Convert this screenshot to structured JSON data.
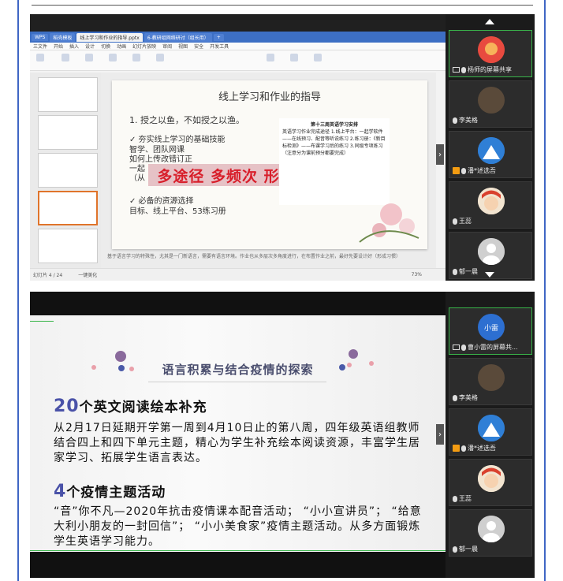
{
  "top": {
    "titlebar_tabs": [
      "WPS",
      "稻壳模板",
      "线上学习和作业的指导.pptx",
      "6-教研组网络研讨（组长用）",
      "+"
    ],
    "menu_items": [
      "三文件",
      "开始",
      "插入",
      "设计",
      "切换",
      "动画",
      "幻灯片放映",
      "审阅",
      "视图",
      "安全",
      "开发工具"
    ],
    "slide": {
      "title": "线上学习和作业的指导",
      "line1": "1. 授之以鱼，不如授之以渔。",
      "line2": "✓ 夯实线上学习的基础技能",
      "line3": "智学、团队网课",
      "line4": "如何上传改错订正",
      "line5": "一起",
      "line6": "（从",
      "banner": "多途径 多频次 形成习惯",
      "line7": "✓ 必备的资源选择",
      "line8": "目标、线上平台、53练习册",
      "note_title": "第十三周英语学习安排",
      "note_body": "英语学习作业完成途径 1.线上平台：一起学软件——在线预习、配音等听说练习 2.练习册：《新目标检测》——布课学习后的练习 3.同级专项练习（注意分为课前预分都要完成）"
    },
    "notes_text": "基于语言学习的特殊性，尤其是一门新语言，需要有语言环境。作业也从多层次多角度进行，在布置作业之前，最好先要设计好（形成习惯）",
    "status_left": "幻灯片 4 / 24",
    "status_mid": "一键美化",
    "zoom": "73%",
    "participants": [
      {
        "name": "杨师的屏幕共享",
        "sharing": true
      },
      {
        "name": "李美格"
      },
      {
        "name": "潘*述选吾"
      },
      {
        "name": "王蕊"
      },
      {
        "name": "郁一晨"
      }
    ]
  },
  "bottom": {
    "section_title": "语言积累与结合疫情的探索",
    "head1_num": "20",
    "head1_text": "个英文阅读绘本补充",
    "para1": "从2月17日延期开学第一周到4月10日止的第八周，四年级英语组教师结合四上和四下单元主题，精心为学生补充绘本阅读资源，丰富学生居家学习、拓展学生语言表达。",
    "head2_num": "4",
    "head2_text": "个疫情主题活动",
    "para2": "“音”你不凡—2020年抗击疫情课本配音活动； “小小宣讲员”； “给意大利小朋友的一封回信”； “小小美食家”疫情主题活动。从多方面锻炼学生英语学习能力。",
    "participants": [
      {
        "name": "曹小雷的屏幕共...",
        "avatar_text": "小雷",
        "sharing": true
      },
      {
        "name": "李美格"
      },
      {
        "name": "潘*述选吾"
      },
      {
        "name": "王蕊"
      },
      {
        "name": "郁一晨"
      }
    ]
  },
  "colors": {
    "accent_green": "#39b54a",
    "wps_blue": "#3d6fc4",
    "banner_red": "#d81e2a",
    "num_blue": "#4a52a8"
  }
}
